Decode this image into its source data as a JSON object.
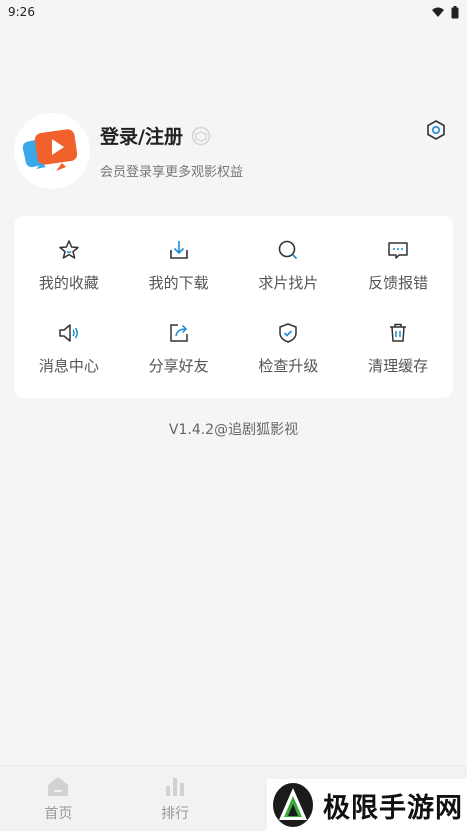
{
  "status_bar": {
    "time": "9:26"
  },
  "profile": {
    "title": "登录/注册",
    "subtitle": "会员登录享更多观影权益"
  },
  "grid": [
    {
      "label": "我的收藏",
      "icon": "star-icon"
    },
    {
      "label": "我的下载",
      "icon": "download-icon"
    },
    {
      "label": "求片找片",
      "icon": "search-icon"
    },
    {
      "label": "反馈报错",
      "icon": "feedback-icon"
    },
    {
      "label": "消息中心",
      "icon": "speaker-icon"
    },
    {
      "label": "分享好友",
      "icon": "share-icon"
    },
    {
      "label": "检查升级",
      "icon": "shield-check-icon"
    },
    {
      "label": "清理缓存",
      "icon": "trash-icon"
    }
  ],
  "version": "V1.4.2@追剧狐影视",
  "bottom_nav": [
    {
      "label": "首页",
      "icon": "home-icon"
    },
    {
      "label": "排行",
      "icon": "chart-icon"
    }
  ],
  "watermark": {
    "text": "极限手游网"
  },
  "colors": {
    "accent": "#1a8cd8",
    "brand_orange": "#f0612c",
    "background": "#f5f5f5"
  }
}
